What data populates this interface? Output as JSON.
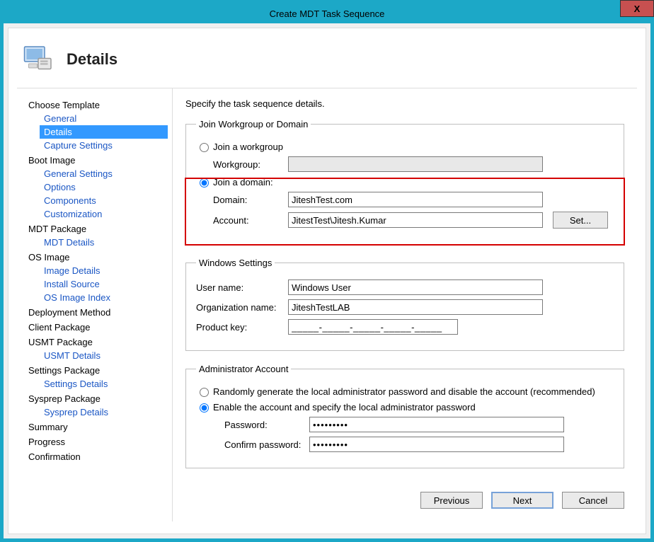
{
  "window": {
    "title": "Create MDT Task Sequence",
    "close_glyph": "X"
  },
  "header": {
    "title": "Details"
  },
  "sidebar": {
    "items": [
      {
        "label": "Choose Template",
        "type": "cat"
      },
      {
        "label": "General",
        "type": "item"
      },
      {
        "label": "Details",
        "type": "item",
        "active": true
      },
      {
        "label": "Capture Settings",
        "type": "item"
      },
      {
        "label": "Boot Image",
        "type": "cat"
      },
      {
        "label": "General Settings",
        "type": "item"
      },
      {
        "label": "Options",
        "type": "item"
      },
      {
        "label": "Components",
        "type": "item"
      },
      {
        "label": "Customization",
        "type": "item"
      },
      {
        "label": "MDT Package",
        "type": "cat"
      },
      {
        "label": "MDT Details",
        "type": "item"
      },
      {
        "label": "OS Image",
        "type": "cat"
      },
      {
        "label": "Image Details",
        "type": "item"
      },
      {
        "label": "Install Source",
        "type": "item"
      },
      {
        "label": "OS Image Index",
        "type": "item"
      },
      {
        "label": "Deployment Method",
        "type": "cat"
      },
      {
        "label": "Client Package",
        "type": "cat"
      },
      {
        "label": "USMT Package",
        "type": "cat"
      },
      {
        "label": "USMT Details",
        "type": "item"
      },
      {
        "label": "Settings Package",
        "type": "cat"
      },
      {
        "label": "Settings Details",
        "type": "item"
      },
      {
        "label": "Sysprep Package",
        "type": "cat"
      },
      {
        "label": "Sysprep Details",
        "type": "item"
      },
      {
        "label": "Summary",
        "type": "cat"
      },
      {
        "label": "Progress",
        "type": "cat"
      },
      {
        "label": "Confirmation",
        "type": "cat"
      }
    ]
  },
  "content": {
    "instruction": "Specify the task sequence details.",
    "join_group": {
      "legend": "Join Workgroup or Domain",
      "workgroup_radio": "Join a workgroup",
      "workgroup_label": "Workgroup:",
      "workgroup_value": "",
      "domain_radio": "Join a domain:",
      "domain_label": "Domain:",
      "domain_value": "JiteshTest.com",
      "account_label": "Account:",
      "account_value": "JitestTest\\Jitesh.Kumar",
      "set_button": "Set..."
    },
    "windows_group": {
      "legend": "Windows Settings",
      "username_label": "User name:",
      "username_value": "Windows User",
      "orgname_label": "Organization name:",
      "orgname_value": "JiteshTestLAB",
      "productkey_label": "Product key:",
      "productkey_value": "_____-_____-_____-_____-_____"
    },
    "admin_group": {
      "legend": "Administrator Account",
      "random_radio": "Randomly generate the local administrator password and disable the account (recommended)",
      "enable_radio": "Enable the account and specify the local administrator password",
      "password_label": "Password:",
      "password_value": "•••••••••",
      "confirm_label": "Confirm password:",
      "confirm_value": "•••••••••"
    }
  },
  "footer": {
    "previous": "Previous",
    "next": "Next",
    "cancel": "Cancel"
  }
}
